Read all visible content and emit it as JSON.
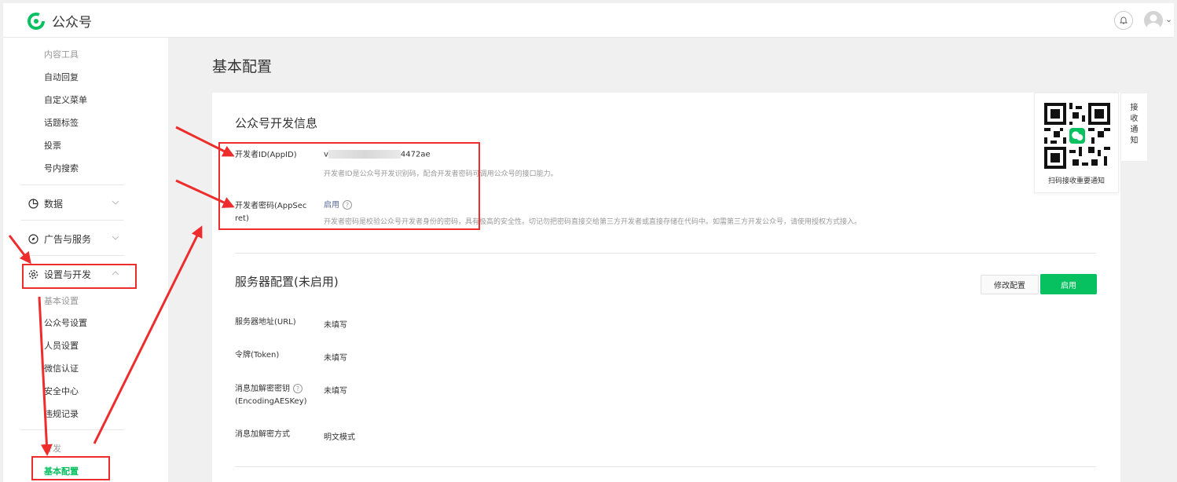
{
  "header": {
    "app_name": "公众号"
  },
  "sidebar": {
    "content_tools": {
      "heading": "内容工具",
      "items": [
        "自动回复",
        "自定义菜单",
        "话题标签",
        "投票",
        "号内搜索"
      ]
    },
    "groups": {
      "data": "数据",
      "ads": "广告与服务",
      "settings": "设置与开发"
    },
    "basic_settings": {
      "heading": "基本设置",
      "items": [
        "公众号设置",
        "人员设置",
        "微信认证",
        "安全中心",
        "违规记录"
      ]
    },
    "develop": {
      "heading": "开发",
      "active_item": "基本配置"
    }
  },
  "main": {
    "page_title": "基本配置",
    "dev_info": {
      "title": "公众号开发信息",
      "appid_label": "开发者ID(AppID)",
      "appid_prefix": "v",
      "appid_suffix": "4472ae",
      "appid_desc": "开发者ID是公众号开发识别码，配合开发者密码可调用公众号的接口能力。",
      "secret_label_line1": "开发者密码(AppSec",
      "secret_label_line2": "ret)",
      "secret_value": "启用",
      "secret_desc": "开发者密码是校验公众号开发者身份的密码，具有极高的安全性。切记勿把密码直接交给第三方开发者或直接存储在代码中。如需第三方开发公众号，请使用授权方式接入。"
    },
    "server_config": {
      "title": "服务器配置(未启用)",
      "modify_button": "修改配置",
      "enable_button": "启用",
      "url_label": "服务器地址(URL)",
      "url_value": "未填写",
      "token_label": "令牌(Token)",
      "token_value": "未填写",
      "aes_label_line1": "消息加解密密钥",
      "aes_label_line2": "(EncodingAESKey)",
      "aes_value": "未填写",
      "mode_label": "消息加解密方式",
      "mode_value": "明文模式"
    },
    "qr": {
      "caption": "扫码接收重要通知"
    },
    "notify_tab": [
      "接",
      "收",
      "通",
      "知"
    ]
  },
  "colors": {
    "brand_green": "#07c160",
    "annotation_red": "#ee2c2c",
    "link_blue": "#576b95"
  }
}
